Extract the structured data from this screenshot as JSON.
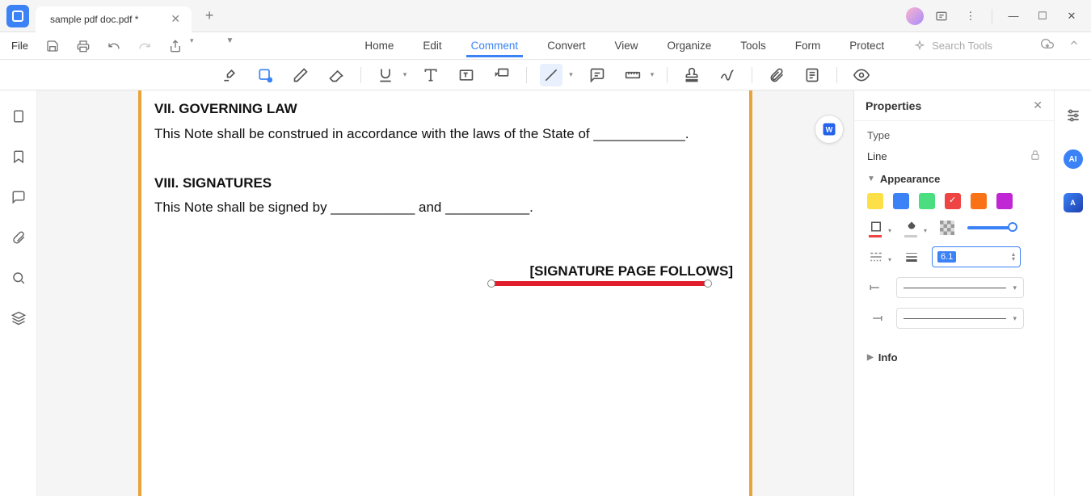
{
  "titlebar": {
    "tab_title": "sample pdf doc.pdf *"
  },
  "menubar": {
    "file": "File",
    "items": [
      "Home",
      "Edit",
      "Comment",
      "Convert",
      "View",
      "Organize",
      "Tools",
      "Form",
      "Protect"
    ],
    "active_index": 2,
    "search_placeholder": "Search Tools"
  },
  "document": {
    "h1": "VII. GOVERNING LAW",
    "p1": "This Note shall be construed in accordance with the laws of the State of ____________.",
    "h2": "VIII. SIGNATURES",
    "p2": "This Note shall be signed by ___________ and ___________.",
    "sig": "[SIGNATURE PAGE FOLLOWS]"
  },
  "properties": {
    "title": "Properties",
    "type_label": "Type",
    "type_value": "Line",
    "appearance_label": "Appearance",
    "colors": [
      "#fde047",
      "#3b82f6",
      "#4ade80",
      "#ef4444",
      "#f97316",
      "#c026d3"
    ],
    "selected_color_index": 3,
    "thickness_value": "6.1",
    "info_label": "Info"
  }
}
